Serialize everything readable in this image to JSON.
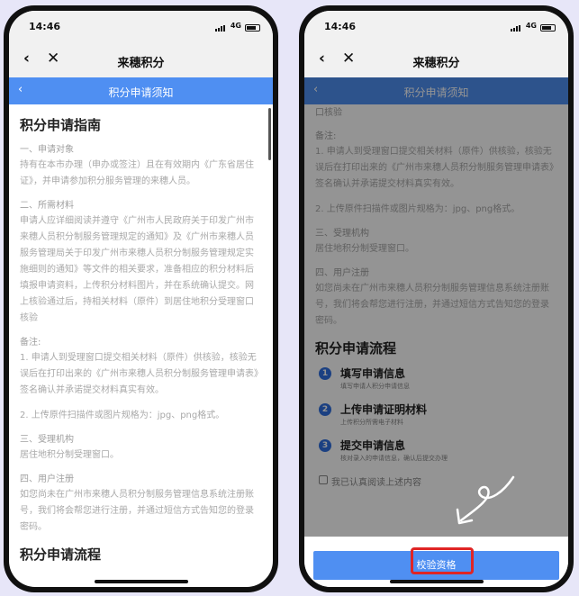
{
  "status": {
    "time": "14:46",
    "network": "4G"
  },
  "nav": {
    "back_icon": "‹",
    "close_icon": "✕",
    "title": "来穗积分"
  },
  "subbar": {
    "back_icon": "‹",
    "title": "积分申请须知"
  },
  "notice": {
    "heading": "积分申请指南",
    "s1_title": "一、申请对象",
    "s1_body": "持有在本市办理（申办或签注）且在有效期内《广东省居住证》，并申请参加积分服务管理的来穗人员。",
    "s2_title": "二、所需材料",
    "s2_body": "申请人应详细阅读并遵守《广州市人民政府关于印发广州市来穗人员积分制服务管理规定的通知》及《广州市来穗人员服务管理局关于印发广州市来穗人员积分制服务管理规定实施细则的通知》等文件的相关要求，准备相应的积分材料后填报申请资料，上传积分材料图片，并在系统确认提交。网上核验通过后，持相关材料（原件）到居住地积分受理窗口核验",
    "s2_tail": "口核验",
    "note_title": "备注:",
    "note_body": "1. 申请人到受理窗口提交相关材料（原件）供核验，核验无误后在打印出来的《广州市来穗人员积分制服务管理申请表》签名确认并承诺提交材料真实有效。",
    "note_2": "2. 上传原件扫描件或图片规格为：jpg、png格式。",
    "s3_title": "三、受理机构",
    "s3_body": "居住地积分制受理窗口。",
    "s4_title": "四、用户注册",
    "s4_body": "如您尚未在广州市来穗人员积分制服务管理信息系统注册账号，我们将会帮您进行注册，并通过短信方式告知您的登录密码。",
    "flow_heading": "积分申请流程"
  },
  "flow": {
    "steps": [
      {
        "num": "1",
        "title": "填写申请信息",
        "desc": "填写申请人积分申请信息"
      },
      {
        "num": "2",
        "title": "上传申请证明材料",
        "desc": "上传积分所需电子材料"
      },
      {
        "num": "3",
        "title": "提交申请信息",
        "desc": "核对录入的申请信息，确认后提交办理"
      }
    ],
    "agree_label": "我已认真阅读上述内容",
    "verify_label": "校验资格"
  }
}
